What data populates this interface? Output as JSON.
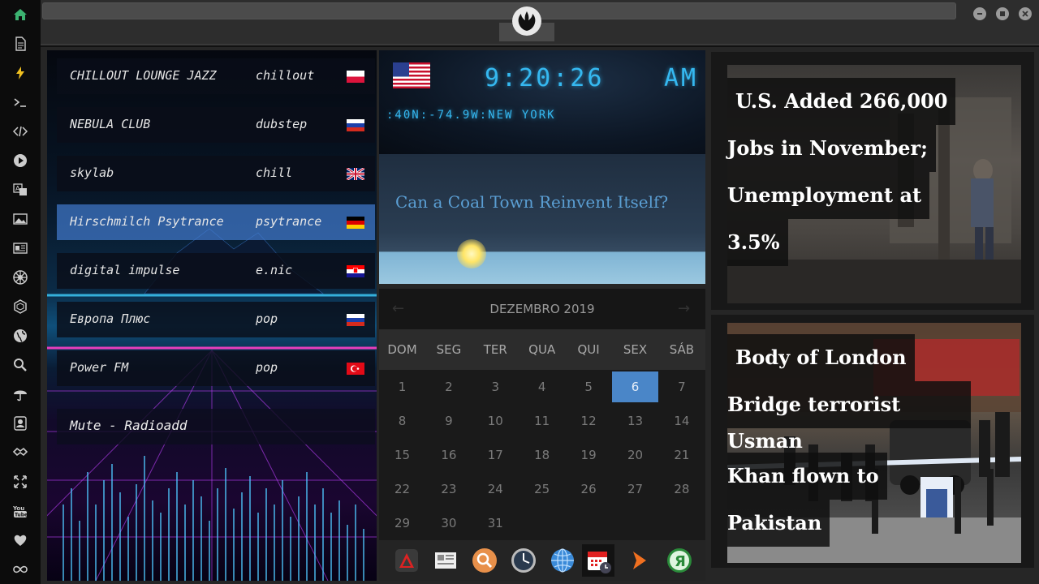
{
  "sidebar": {
    "icons": [
      "home-icon",
      "file-icon",
      "bolt-icon",
      "terminal-icon",
      "code-icon",
      "play-icon",
      "translate-icon",
      "image-icon",
      "news-icon",
      "galactic-empire-icon",
      "hexagon-icon",
      "globe-icon",
      "search-icon",
      "umbrella-icon",
      "contact-icon",
      "handshake-icon",
      "fullscreen-icon",
      "youtube-icon",
      "heart-icon",
      "infinity-icon"
    ]
  },
  "topbar": {
    "logo": "rebel-alliance-logo"
  },
  "radio": {
    "stations": [
      {
        "name": "CHILLOUT LOUNGE JAZZ",
        "genre": "chillout",
        "flag": "poland"
      },
      {
        "name": "NEBULA CLUB",
        "genre": "dubstep",
        "flag": "russia"
      },
      {
        "name": "skylab",
        "genre": "chill",
        "flag": "united-kingdom"
      },
      {
        "name": "Hirschmilch Psytrance",
        "genre": "psytrance",
        "flag": "germany"
      },
      {
        "name": "digital impulse",
        "genre": "e.nic",
        "flag": "croatia"
      },
      {
        "name": "Европа Плюс",
        "genre": "pop",
        "flag": "russia"
      },
      {
        "name": "Power FM",
        "genre": "pop",
        "flag": "turkey"
      }
    ],
    "active_index": 3,
    "mute_label": "Mute - Radioadd"
  },
  "clock": {
    "time": "9:20:26",
    "ampm": "AM",
    "location": ":40N:-74.9W:NEW YORK",
    "flag": "united-states"
  },
  "weather": {
    "headline": "Can a Coal Town Reinvent Itself?"
  },
  "calendar": {
    "title": "DEZEMBRO 2019",
    "weekdays": [
      "DOM",
      "SEG",
      "TER",
      "QUA",
      "QUI",
      "SEX",
      "SÁB"
    ],
    "days": [
      1,
      2,
      3,
      4,
      5,
      6,
      7,
      8,
      9,
      10,
      11,
      12,
      13,
      14,
      15,
      16,
      17,
      18,
      19,
      20,
      21,
      22,
      23,
      24,
      25,
      26,
      27,
      28,
      29,
      30,
      31
    ],
    "today": 6,
    "prev_arrow": "←",
    "next_arrow": "→"
  },
  "dock": {
    "apps": [
      "launcher-icon",
      "news-reader-icon",
      "search-app-icon",
      "clock-app-icon",
      "browser-icon",
      "calendar-app-icon",
      "forward-app-icon",
      "yandex-icon"
    ],
    "selected_index": 5
  },
  "news": [
    {
      "lines": [
        "U.S. Added 266,000",
        "Jobs in November;",
        "Unemployment at",
        "3.5%"
      ]
    },
    {
      "lines": [
        "Body of London",
        "Bridge terrorist Usman",
        "Khan flown to",
        "Pakistan"
      ]
    }
  ]
}
